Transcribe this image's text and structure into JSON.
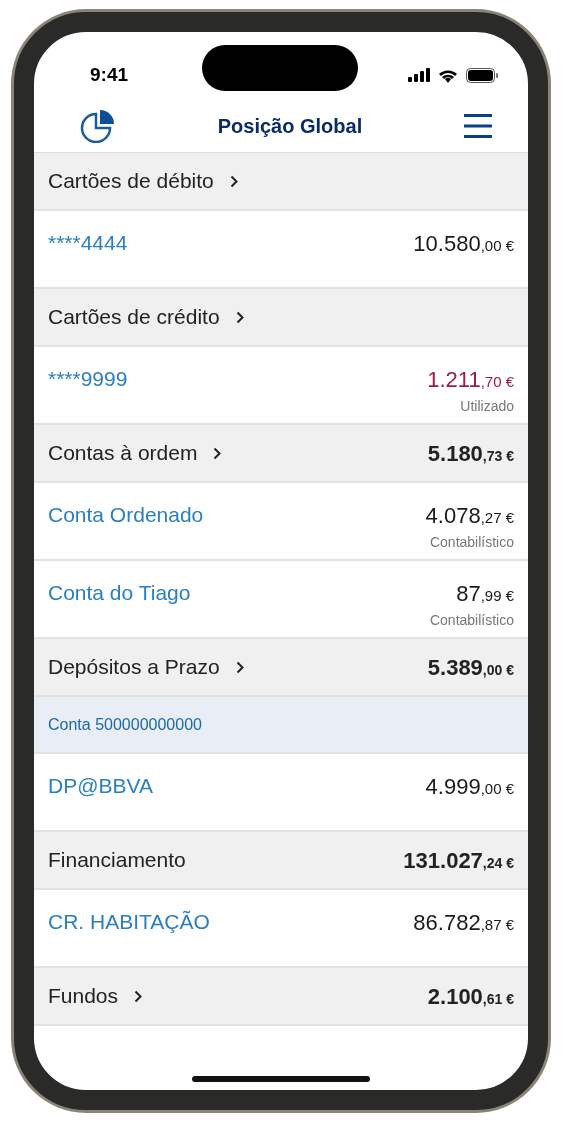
{
  "status_bar": {
    "time": "9:41"
  },
  "header": {
    "title": "Posição Global"
  },
  "rows": [
    {
      "kind": "section",
      "title": "Cartões de débito",
      "expandable": true
    },
    {
      "kind": "item",
      "name": "****4444",
      "amount_int": "10.580",
      "amount_dec": ",00 €",
      "color": "#1a1a1a"
    },
    {
      "kind": "section",
      "title": "Cartões de crédito",
      "expandable": true
    },
    {
      "kind": "item",
      "name": "****9999",
      "amount_int": "1.211",
      "amount_dec": ",70 €",
      "color": "#9b1b4a",
      "note": "Utilizado"
    },
    {
      "kind": "section",
      "title": "Contas à ordem",
      "expandable": true,
      "amount_int": "5.180",
      "amount_dec": ",73 €"
    },
    {
      "kind": "item",
      "name": "Conta Ordenado",
      "amount_int": "4.078",
      "amount_dec": ",27 €",
      "color": "#1a1a1a",
      "note": "Contabilístico"
    },
    {
      "kind": "item",
      "name": "Conta do Tiago",
      "amount_int": "87",
      "amount_dec": ",99 €",
      "color": "#1a1a1a",
      "note": "Contabilístico"
    },
    {
      "kind": "section",
      "title": "Depósitos a Prazo",
      "expandable": true,
      "amount_int": "5.389",
      "amount_dec": ",00 €"
    },
    {
      "kind": "subheader",
      "title": "Conta 500000000000"
    },
    {
      "kind": "item",
      "name": "DP@BBVA",
      "amount_int": "4.999",
      "amount_dec": ",00 €",
      "color": "#1a1a1a"
    },
    {
      "kind": "section",
      "title": "Financiamento",
      "expandable": false,
      "amount_int": "131.027",
      "amount_dec": ",24 €"
    },
    {
      "kind": "item",
      "name": "CR. HABITAÇÃO",
      "amount_int": "86.782",
      "amount_dec": ",87 €",
      "color": "#1a1a1a"
    },
    {
      "kind": "section",
      "title": "Fundos",
      "expandable": true,
      "amount_int": "2.100",
      "amount_dec": ",61 €"
    }
  ]
}
